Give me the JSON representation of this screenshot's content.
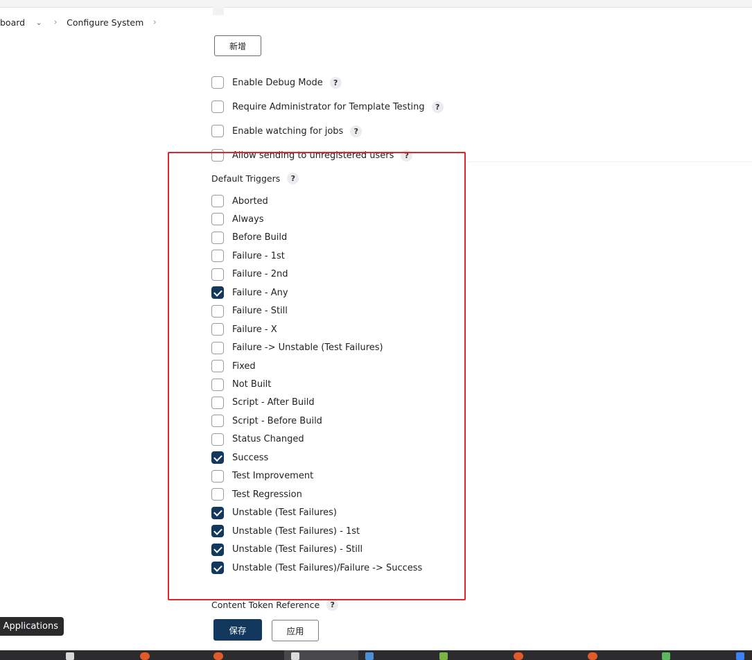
{
  "breadcrumb": {
    "dashboard": "board",
    "page": "Configure System"
  },
  "top": {
    "add_button": "新增"
  },
  "options": [
    {
      "label": "Enable Debug Mode",
      "checked": false
    },
    {
      "label": "Require Administrator for Template Testing",
      "checked": false
    },
    {
      "label": "Enable watching for jobs",
      "checked": false
    },
    {
      "label": "Allow sending to unregistered users",
      "checked": false
    }
  ],
  "help_glyph": "?",
  "default_triggers": {
    "label": "Default Triggers",
    "items": [
      {
        "label": "Aborted",
        "checked": false
      },
      {
        "label": "Always",
        "checked": false
      },
      {
        "label": "Before Build",
        "checked": false
      },
      {
        "label": "Failure - 1st",
        "checked": false
      },
      {
        "label": "Failure - 2nd",
        "checked": false
      },
      {
        "label": "Failure - Any",
        "checked": true
      },
      {
        "label": "Failure - Still",
        "checked": false
      },
      {
        "label": "Failure - X",
        "checked": false
      },
      {
        "label": "Failure -> Unstable (Test Failures)",
        "checked": false
      },
      {
        "label": "Fixed",
        "checked": false
      },
      {
        "label": "Not Built",
        "checked": false
      },
      {
        "label": "Script - After Build",
        "checked": false
      },
      {
        "label": "Script - Before Build",
        "checked": false
      },
      {
        "label": "Status Changed",
        "checked": false
      },
      {
        "label": "Success",
        "checked": true
      },
      {
        "label": "Test Improvement",
        "checked": false
      },
      {
        "label": "Test Regression",
        "checked": false
      },
      {
        "label": "Unstable (Test Failures)",
        "checked": true
      },
      {
        "label": "Unstable (Test Failures) - 1st",
        "checked": true
      },
      {
        "label": "Unstable (Test Failures) - Still",
        "checked": true
      },
      {
        "label": "Unstable (Test Failures)/Failure -> Success",
        "checked": true
      }
    ]
  },
  "content_token": {
    "label": "Content Token Reference"
  },
  "footer": {
    "save": "保存",
    "apply": "应用"
  },
  "tooltip": "y Applications",
  "colors": {
    "primary": "#12385e",
    "highlight": "#e0242c"
  }
}
